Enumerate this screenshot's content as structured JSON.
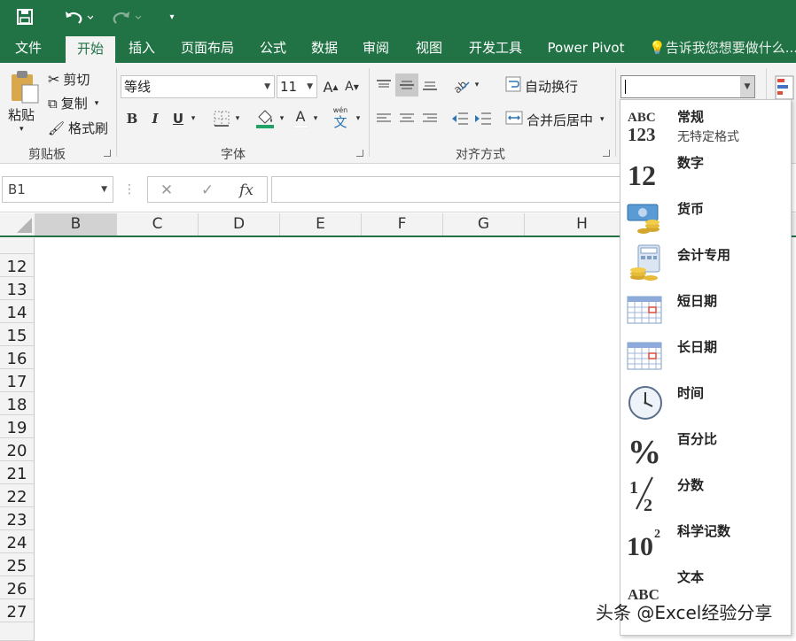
{
  "colors": {
    "brand": "#217346",
    "ribbon_bg": "#f3f3f3",
    "fill_color_accent": "#21a366"
  },
  "quick_access": {
    "save_icon": "save-icon",
    "undo_icon": "undo-icon",
    "redo_icon": "redo-icon",
    "customize_icon": "customize-icon"
  },
  "tabs": [
    {
      "label": "文件"
    },
    {
      "label": "开始",
      "active": true
    },
    {
      "label": "插入"
    },
    {
      "label": "页面布局"
    },
    {
      "label": "公式"
    },
    {
      "label": "数据"
    },
    {
      "label": "审阅"
    },
    {
      "label": "视图"
    },
    {
      "label": "开发工具"
    },
    {
      "label": "Power Pivot"
    }
  ],
  "tell_me": "告诉我您想要做什么...",
  "clipboard": {
    "paste": "粘贴",
    "cut": "剪切",
    "copy": "复制",
    "format_painter": "格式刷",
    "group": "剪贴板"
  },
  "font": {
    "name": "等线",
    "size": "11",
    "grow": "A",
    "shrink": "A",
    "bold": "B",
    "italic": "I",
    "underline": "U",
    "font_color": "A",
    "phonetic": "wén",
    "phonetic_char": "文",
    "group": "字体"
  },
  "alignment": {
    "wrap": "自动换行",
    "merge": "合并后居中",
    "group": "对齐方式"
  },
  "number_format": {
    "value": ""
  },
  "formula_bar": {
    "name_box": "B1",
    "fx": "fx",
    "cancel": "✕",
    "enter": "✓",
    "formula": ""
  },
  "columns": [
    "B",
    "C",
    "D",
    "E",
    "F",
    "G",
    "H"
  ],
  "rows": [
    "12",
    "13",
    "14",
    "15",
    "16",
    "17",
    "18",
    "19",
    "20",
    "21",
    "22",
    "23",
    "24",
    "25",
    "26",
    "27"
  ],
  "format_menu": [
    {
      "label": "常规",
      "sub": "无特定格式",
      "icon": "general-abc123-icon"
    },
    {
      "label": "数字",
      "icon": "number-12-icon"
    },
    {
      "label": "货币",
      "icon": "currency-icon"
    },
    {
      "label": "会计专用",
      "icon": "accounting-icon"
    },
    {
      "label": "短日期",
      "icon": "short-date-calendar-icon"
    },
    {
      "label": "长日期",
      "icon": "long-date-calendar-icon"
    },
    {
      "label": "时间",
      "icon": "clock-icon"
    },
    {
      "label": "百分比",
      "icon": "percent-icon"
    },
    {
      "label": "分数",
      "icon": "fraction-icon"
    },
    {
      "label": "科学记数",
      "icon": "scientific-icon"
    },
    {
      "label": "文本",
      "icon": "text-abc-icon"
    }
  ],
  "watermark": "头条 @Excel经验分享"
}
